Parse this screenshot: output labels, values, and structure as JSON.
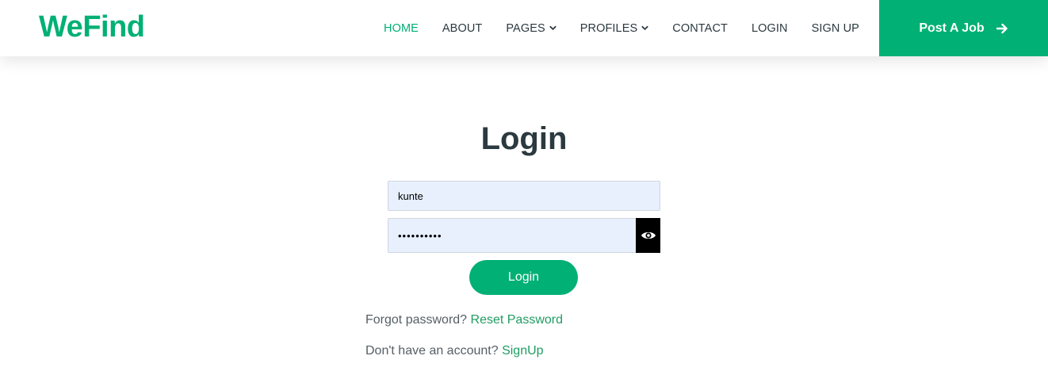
{
  "header": {
    "brand": "WeFind",
    "nav": [
      {
        "label": "HOME",
        "active": true,
        "dropdown": false
      },
      {
        "label": "ABOUT",
        "active": false,
        "dropdown": false
      },
      {
        "label": "PAGES",
        "active": false,
        "dropdown": true
      },
      {
        "label": "PROFILES",
        "active": false,
        "dropdown": true
      },
      {
        "label": "CONTACT",
        "active": false,
        "dropdown": false
      },
      {
        "label": "LOGIN",
        "active": false,
        "dropdown": false
      },
      {
        "label": "SIGN UP",
        "active": false,
        "dropdown": false
      }
    ],
    "post_job_label": "Post A Job",
    "post_job_icon": "arrow-right-icon"
  },
  "login": {
    "title": "Login",
    "username_value": "kunte",
    "password_value": "••••••••••",
    "toggle_icon": "eye-icon",
    "submit_label": "Login",
    "forgot_text": "Forgot password?",
    "reset_link": "Reset Password",
    "no_account_text": "Don't have an account?",
    "signup_link": "SignUp"
  },
  "colors": {
    "accent": "#00b074",
    "heading": "#2b3940",
    "input_bg": "#e8f0fe"
  }
}
